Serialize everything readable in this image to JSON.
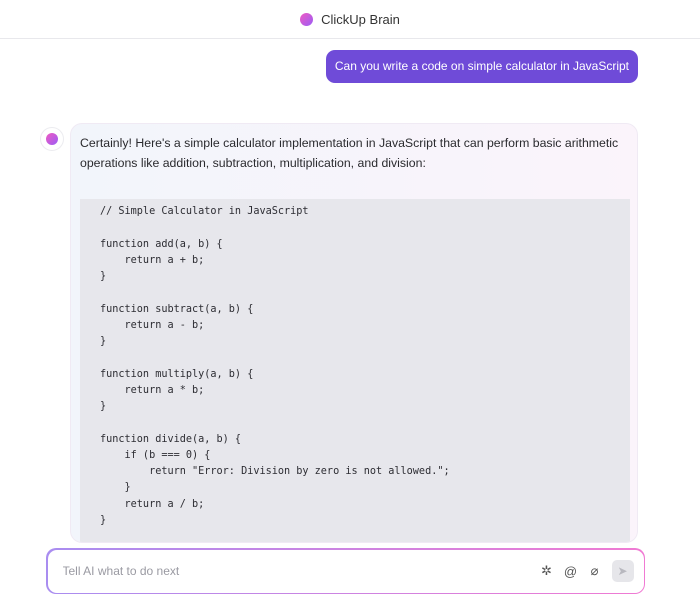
{
  "header": {
    "title": "ClickUp Brain"
  },
  "user_message": "Can you write a code on simple calculator in JavaScript",
  "assistant": {
    "intro": "Certainly! Here's a simple calculator implementation in JavaScript that can perform basic arithmetic operations like addition, subtraction, multiplication, and division:",
    "code": "// Simple Calculator in JavaScript\n\nfunction add(a, b) {\n    return a + b;\n}\n\nfunction subtract(a, b) {\n    return a - b;\n}\n\nfunction multiply(a, b) {\n    return a * b;\n}\n\nfunction divide(a, b) {\n    if (b === 0) {\n        return \"Error: Division by zero is not allowed.\";\n    }\n    return a / b;\n}\n\n"
  },
  "input": {
    "placeholder": "Tell AI what to do next",
    "value": ""
  },
  "icons": {
    "sparkle": "sparkle-icon",
    "mention": "at-icon",
    "attach": "paperclip-icon",
    "send": "send-icon"
  }
}
